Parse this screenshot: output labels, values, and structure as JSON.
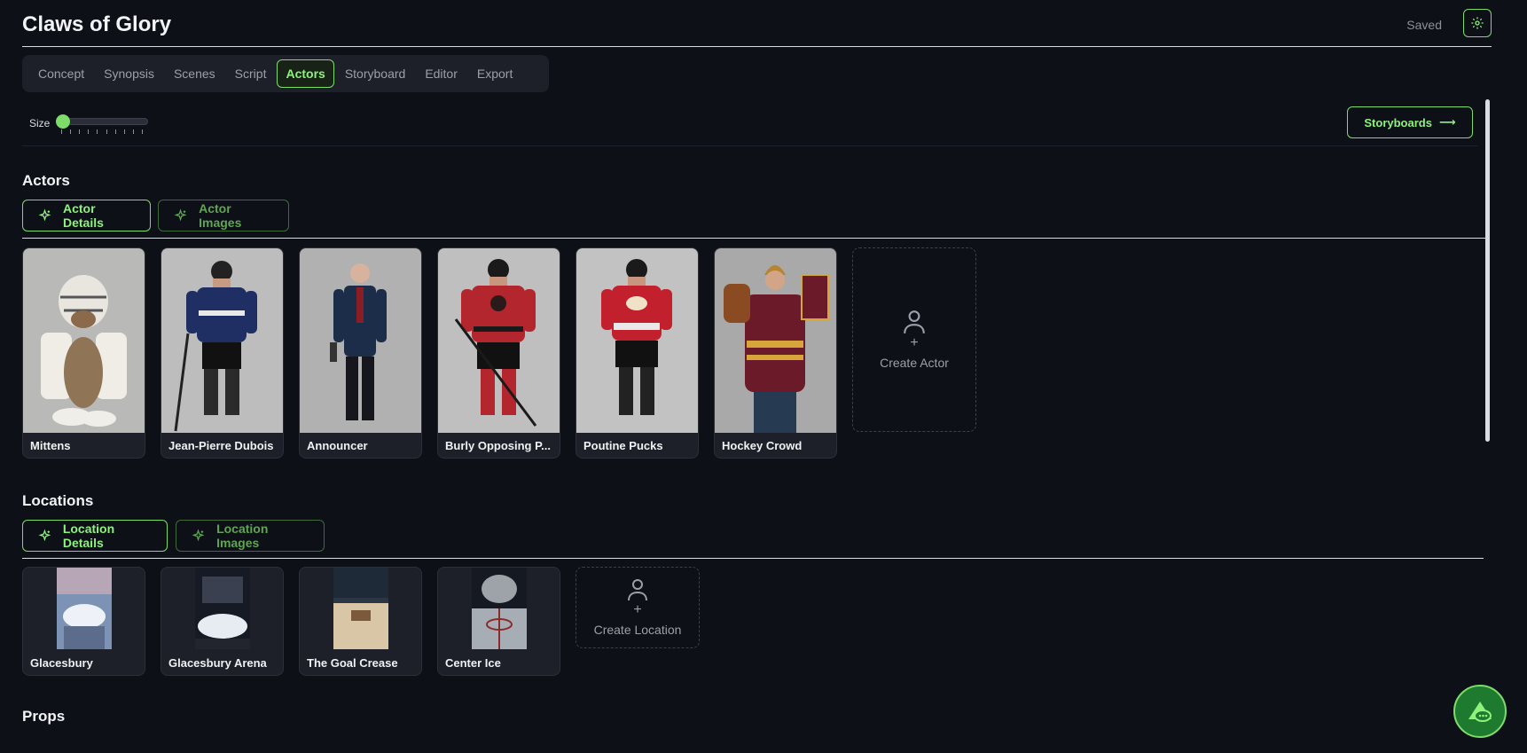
{
  "header": {
    "title": "Claws of Glory",
    "saved": "Saved"
  },
  "tabs": [
    {
      "label": "Concept"
    },
    {
      "label": "Synopsis"
    },
    {
      "label": "Scenes"
    },
    {
      "label": "Script"
    },
    {
      "label": "Actors",
      "active": true
    },
    {
      "label": "Storyboard"
    },
    {
      "label": "Editor"
    },
    {
      "label": "Export"
    }
  ],
  "toolbar": {
    "size_label": "Size",
    "storyboards_label": "Storyboards",
    "slider_value": 0
  },
  "actors": {
    "title": "Actors",
    "details_button": "Actor Details",
    "images_button": "Actor Images",
    "items": [
      {
        "name": "Mittens"
      },
      {
        "name": "Jean-Pierre Dubois"
      },
      {
        "name": "Announcer"
      },
      {
        "name": "Burly Opposing P..."
      },
      {
        "name": "Poutine Pucks"
      },
      {
        "name": "Hockey Crowd"
      }
    ],
    "create_label": "Create Actor"
  },
  "locations": {
    "title": "Locations",
    "details_button": "Location Details",
    "images_button": "Location Images",
    "items": [
      {
        "name": "Glacesbury"
      },
      {
        "name": "Glacesbury Arena"
      },
      {
        "name": "The Goal Crease"
      },
      {
        "name": "Center Ice"
      }
    ],
    "create_label": "Create Location"
  },
  "props": {
    "title": "Props"
  },
  "colors": {
    "accent": "#7ddc6a",
    "background": "#0d1017",
    "panel": "#1d2029"
  }
}
